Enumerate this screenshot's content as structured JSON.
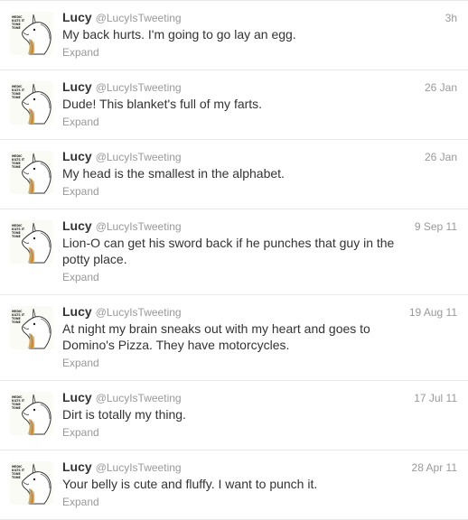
{
  "tweets": [
    {
      "name": "Lucy",
      "handle": "@LucyIsTweeting",
      "time": "3h",
      "text": "My back hurts. I'm going to go lay an egg.",
      "expand": "Expand",
      "avatar_text": "MEDIC KILTS IT TONE TONE"
    },
    {
      "name": "Lucy",
      "handle": "@LucyIsTweeting",
      "time": "26 Jan",
      "text": "Dude! This blanket's full of my farts.",
      "expand": "Expand",
      "avatar_text": "MEDIC KILTS IT TONE TONE"
    },
    {
      "name": "Lucy",
      "handle": "@LucyIsTweeting",
      "time": "26 Jan",
      "text": "My head is the smallest in the alphabet.",
      "expand": "Expand",
      "avatar_text": "MEDIC KILTS IT TONE TONE"
    },
    {
      "name": "Lucy",
      "handle": "@LucyIsTweeting",
      "time": "9 Sep 11",
      "text": "Lion-O can get his sword back if he punches that guy in the potty place.",
      "expand": "Expand",
      "avatar_text": "MEDIC KILTS IT TONE TONE"
    },
    {
      "name": "Lucy",
      "handle": "@LucyIsTweeting",
      "time": "19 Aug 11",
      "text": "At night my brain sneaks out with my heart and goes to Domino's Pizza. They have motorcycles.",
      "expand": "Expand",
      "avatar_text": "MEDIC KILTS IT TONE TONE"
    },
    {
      "name": "Lucy",
      "handle": "@LucyIsTweeting",
      "time": "17 Jul 11",
      "text": "Dirt is totally my thing.",
      "expand": "Expand",
      "avatar_text": "MEDIC KILTS IT TONE TONE"
    },
    {
      "name": "Lucy",
      "handle": "@LucyIsTweeting",
      "time": "28 Apr 11",
      "text": "Your belly is cute and fluffy. I want to punch it.",
      "expand": "Expand",
      "avatar_text": "MEDIC KILTS IT TONE TONE"
    }
  ],
  "colors": {
    "name": "#333333",
    "meta": "#999999",
    "divider": "#e8e8e8"
  },
  "icons": {
    "avatar": "unicorn-avatar-icon"
  }
}
